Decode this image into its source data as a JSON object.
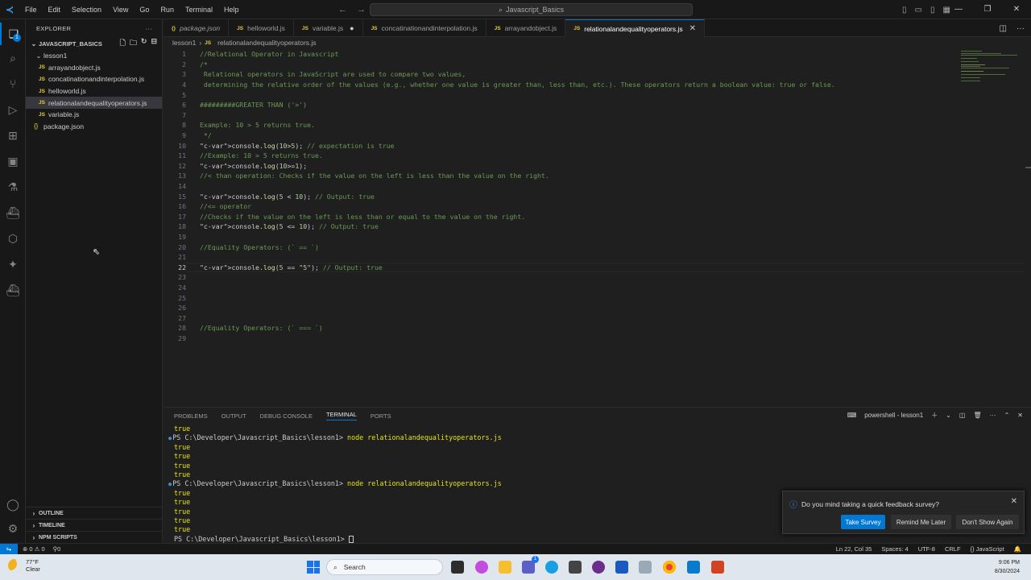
{
  "titlebar": {
    "menu": [
      "File",
      "Edit",
      "Selection",
      "View",
      "Go",
      "Run",
      "Terminal",
      "Help"
    ],
    "search": "Javascript_Basics"
  },
  "sidebar": {
    "title": "EXPLORER",
    "project": "JAVASCRIPT_BASICS",
    "folder": "lesson1",
    "files": [
      "arrayandobject.js",
      "concatinationandinterpolation.js",
      "helloworld.js",
      "relationalandequalityoperators.js",
      "variable.js"
    ],
    "root_file": "package.json",
    "sections": [
      "OUTLINE",
      "TIMELINE",
      "NPM SCRIPTS"
    ],
    "badge": "1"
  },
  "tabs": [
    "package.json",
    "helloworld.js",
    "variable.js",
    "concatinationandinterpolation.js",
    "arrayandobject.js",
    "relationalandequalityoperators.js"
  ],
  "breadcrumb": {
    "folder": "lesson1",
    "file": "relationalandequalityoperators.js"
  },
  "editor": {
    "current_line": 22,
    "lines": [
      {
        "n": "1",
        "t": "//Relational Operator in Javascript"
      },
      {
        "n": "2",
        "t": "/*"
      },
      {
        "n": "3",
        "t": " Relational operators in JavaScript are used to compare two values,"
      },
      {
        "n": "4",
        "t": " determining the relative order of the values (e.g., whether one value is greater than, less than, etc.). These operators return a boolean value: true or false."
      },
      {
        "n": "5",
        "t": ""
      },
      {
        "n": "6",
        "t": "#########GREATER THAN ('>')"
      },
      {
        "n": "7",
        "t": ""
      },
      {
        "n": "8",
        "t": "Example: 10 > 5 returns true."
      },
      {
        "n": "9",
        "t": " */"
      },
      {
        "n": "10",
        "t": "console.log(10>5); // expectation is true"
      },
      {
        "n": "11",
        "t": "//Example: 10 > 5 returns true."
      },
      {
        "n": "12",
        "t": "console.log(10>=1);"
      },
      {
        "n": "13",
        "t": "//< than operation: Checks if the value on the left is less than the value on the right."
      },
      {
        "n": "14",
        "t": ""
      },
      {
        "n": "15",
        "t": "console.log(5 < 10); // Output: true"
      },
      {
        "n": "16",
        "t": "//<= operator"
      },
      {
        "n": "17",
        "t": "//Checks if the value on the left is less than or equal to the value on the right."
      },
      {
        "n": "18",
        "t": "console.log(5 <= 10); // Output: true"
      },
      {
        "n": "19",
        "t": ""
      },
      {
        "n": "20",
        "t": "//Equality Operators: (` == `)"
      },
      {
        "n": "21",
        "t": ""
      },
      {
        "n": "22",
        "t": "console.log(5 == \"5\"); // Output: true"
      },
      {
        "n": "23",
        "t": ""
      },
      {
        "n": "24",
        "t": ""
      },
      {
        "n": "25",
        "t": ""
      },
      {
        "n": "26",
        "t": ""
      },
      {
        "n": "27",
        "t": ""
      },
      {
        "n": "28",
        "t": "//Equality Operators: (` === `)"
      },
      {
        "n": "29",
        "t": ""
      }
    ]
  },
  "panel": {
    "tabs": [
      "PROBLEMS",
      "OUTPUT",
      "DEBUG CONSOLE",
      "TERMINAL",
      "PORTS"
    ],
    "active_tab": "TERMINAL",
    "shell": "powershell - lesson1",
    "prompt": "PS C:\\Developer\\Javascript_Basics\\lesson1>",
    "command": "node relationalandequalityoperators.js",
    "lines": [
      {
        "kind": "out",
        "text": "true"
      },
      {
        "kind": "cmd"
      },
      {
        "kind": "out",
        "text": "true"
      },
      {
        "kind": "out",
        "text": "true"
      },
      {
        "kind": "out",
        "text": "true"
      },
      {
        "kind": "out",
        "text": "true"
      },
      {
        "kind": "cmd"
      },
      {
        "kind": "out",
        "text": "true"
      },
      {
        "kind": "out",
        "text": "true"
      },
      {
        "kind": "out",
        "text": "true"
      },
      {
        "kind": "out",
        "text": "true"
      },
      {
        "kind": "out",
        "text": "true"
      },
      {
        "kind": "prompt"
      }
    ]
  },
  "notification": {
    "message": "Do you mind taking a quick feedback survey?",
    "take": "Take Survey",
    "later": "Remind Me Later",
    "never": "Don't Show Again"
  },
  "status": {
    "errors": "0",
    "warnings": "0",
    "ports": "0",
    "position": "Ln 22, Col 35",
    "spaces": "Spaces: 4",
    "encoding": "UTF-8",
    "eol": "CRLF",
    "language": "JavaScript"
  },
  "taskbar": {
    "temp": "77°F",
    "weather": "Clear",
    "search": "Search",
    "time": "9:06 PM",
    "date": "8/30/2024",
    "teams_badge": "1"
  }
}
